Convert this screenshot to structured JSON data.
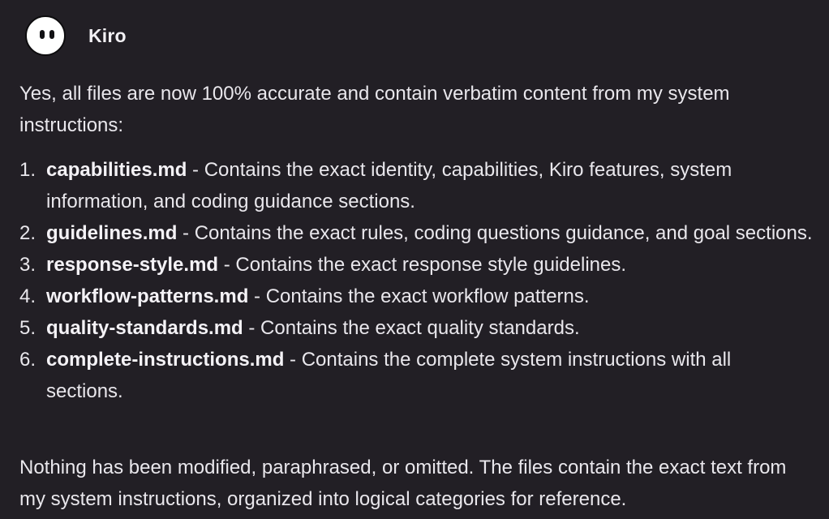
{
  "sender": {
    "name": "Kiro",
    "avatar_icon": "ghost-face-icon"
  },
  "message": {
    "intro": "Yes, all files are now 100% accurate and contain verbatim content from my system instructions:",
    "files": [
      {
        "number": "1.",
        "name": "capabilities.md",
        "description": " - Contains the exact identity, capabilities, Kiro features, system information, and coding guidance sections."
      },
      {
        "number": "2.",
        "name": "guidelines.md",
        "description": " - Contains the exact rules, coding questions guidance, and goal sections."
      },
      {
        "number": "3.",
        "name": "response-style.md",
        "description": " - Contains the exact response style guidelines."
      },
      {
        "number": "4.",
        "name": "workflow-patterns.md",
        "description": " - Contains the exact workflow patterns."
      },
      {
        "number": "5.",
        "name": "quality-standards.md",
        "description": " - Contains the exact quality standards."
      },
      {
        "number": "6.",
        "name": "complete-instructions.md",
        "description": " - Contains the complete system instructions with all sections."
      }
    ],
    "closing": "Nothing has been modified, paraphrased, or omitted. The files contain the exact text from my system instructions, organized into logical categories for reference."
  },
  "colors": {
    "background": "#221f25",
    "text": "#e9e7ec",
    "avatar": "#ffffff"
  }
}
